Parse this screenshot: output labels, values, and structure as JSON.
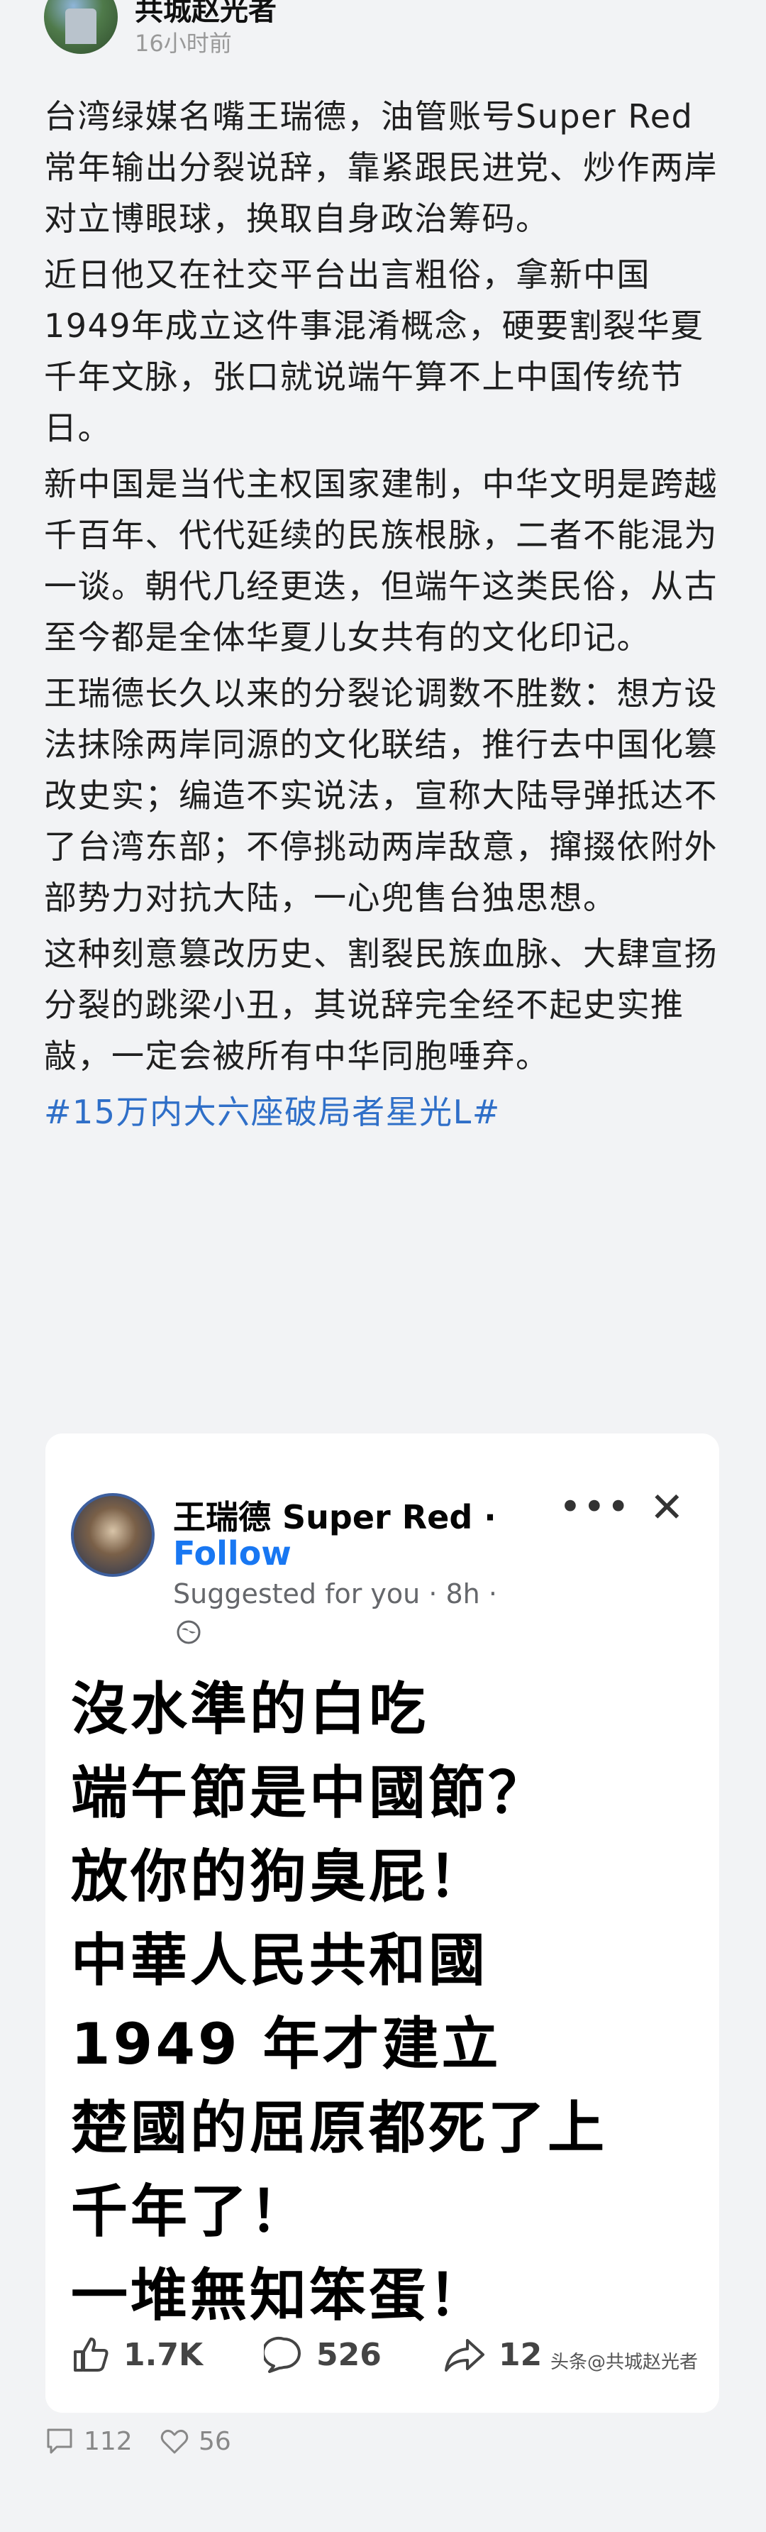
{
  "post": {
    "author": "共城赵光者",
    "time": "16小时前",
    "paragraphs": [
      "台湾绿媒名嘴王瑞德，油管账号Super Red常年输出分裂说辞，靠紧跟民进党、炒作两岸对立博眼球，换取自身政治筹码。",
      "近日他又在社交平台出言粗俗，拿新中国1949年成立这件事混淆概念，硬要割裂华夏千年文脉，张口就说端午算不上中国传统节日。",
      "新中国是当代主权国家建制，中华文明是跨越千百年、代代延续的民族根脉，二者不能混为一谈。朝代几经更迭，但端午这类民俗，从古至今都是全体华夏儿女共有的文化印记。",
      "王瑞德长久以来的分裂论调数不胜数：想方设法抹除两岸同源的文化联结，推行去中国化篡改史实；编造不实说法，宣称大陆导弹抵达不了台湾东部；不停挑动两岸敌意，撺掇依附外部势力对抗大陆，一心兜售台独思想。",
      "这种刻意篡改历史、割裂民族血脉、大肆宣扬分裂的跳梁小丑，其说辞完全经不起史实推敲，一定会被所有中华同胞唾弃。"
    ],
    "hashtag": "#15万内大六座破局者星光L#"
  },
  "embed": {
    "name": "王瑞德 Super Red ·",
    "follow": "Follow",
    "suggested": "Suggested for you · 8h ·",
    "post_lines": [
      "沒水準的白吃",
      "端午節是中國節？",
      "放你的狗臭屁！",
      "中華人民共和國",
      "1949 年才建立",
      "楚國的屈原都死了上",
      "千年了！",
      "一堆無知笨蛋！"
    ],
    "likes": "1.7K",
    "comments": "526",
    "shares": "12",
    "watermark": "头条@共城赵光者"
  },
  "footer": {
    "comments": "112",
    "likes": "56"
  },
  "colors": {
    "hashtag": "#2f6fc8",
    "follow": "#1877f2"
  }
}
